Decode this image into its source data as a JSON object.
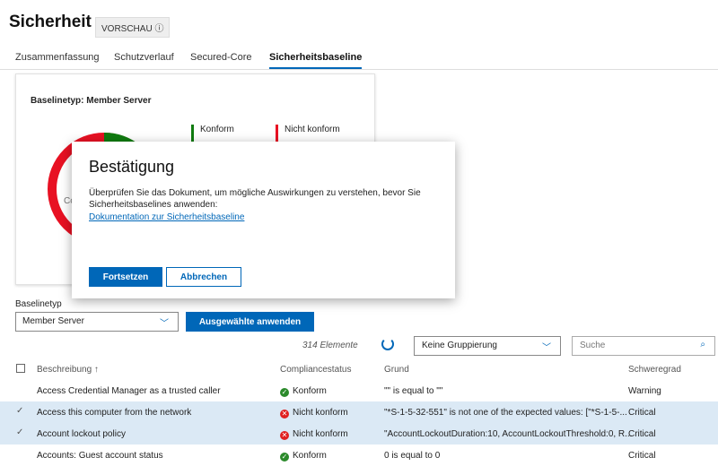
{
  "header": {
    "title": "Sicherheit",
    "badge": "VORSCHAU ⓘ"
  },
  "tabs": [
    {
      "label": "Zusammenfassung"
    },
    {
      "label": "Schutzverlauf"
    },
    {
      "label": "Secured-Core"
    },
    {
      "label": "Sicherheitsbaseline"
    }
  ],
  "card": {
    "title": "Baselinetyp: Member Server",
    "legend_compliant": "Konform",
    "legend_noncompliant": "Nicht konform",
    "center_label_partial": "Co",
    "colors": {
      "compliant": "#107c10",
      "noncompliant": "#e81123"
    }
  },
  "dialog": {
    "title": "Bestätigung",
    "body": "Überprüfen Sie das Dokument, um mögliche Auswirkungen zu verstehen, bevor Sie Sicherheitsbaselines anwenden:",
    "link": "Dokumentation zur Sicherheitsbaseline",
    "ok": "Fortsetzen",
    "cancel": "Abbrechen"
  },
  "controls": {
    "baseline_label": "Baselinetyp",
    "baseline_value": "Member Server",
    "apply": "Ausgewählte anwenden",
    "count": "314 Elemente",
    "grouping": "Keine Gruppierung",
    "search_placeholder": "Suche"
  },
  "table": {
    "headers": {
      "desc": "Beschreibung ↑",
      "status": "Compliancestatus",
      "reason": "Grund",
      "severity": "Schweregrad"
    },
    "rows": [
      {
        "desc": "Access Credential Manager as a trusted caller",
        "status": "Konform",
        "reason": "\"\" is equal to \"\"",
        "severity": "Warning"
      },
      {
        "desc": "Access this computer from the network",
        "status": "Nicht konform",
        "reason": "\"*S-1-5-32-551\" is not one of the expected values: [\"*S-1-5-...",
        "severity": "Critical"
      },
      {
        "desc": "Account lockout policy",
        "status": "Nicht konform",
        "reason": "\"AccountLockoutDuration:10, AccountLockoutThreshold:0, R...",
        "severity": "Critical"
      },
      {
        "desc": "Accounts: Guest account status",
        "status": "Konform",
        "reason": "0 is equal to 0",
        "severity": "Critical"
      }
    ]
  }
}
